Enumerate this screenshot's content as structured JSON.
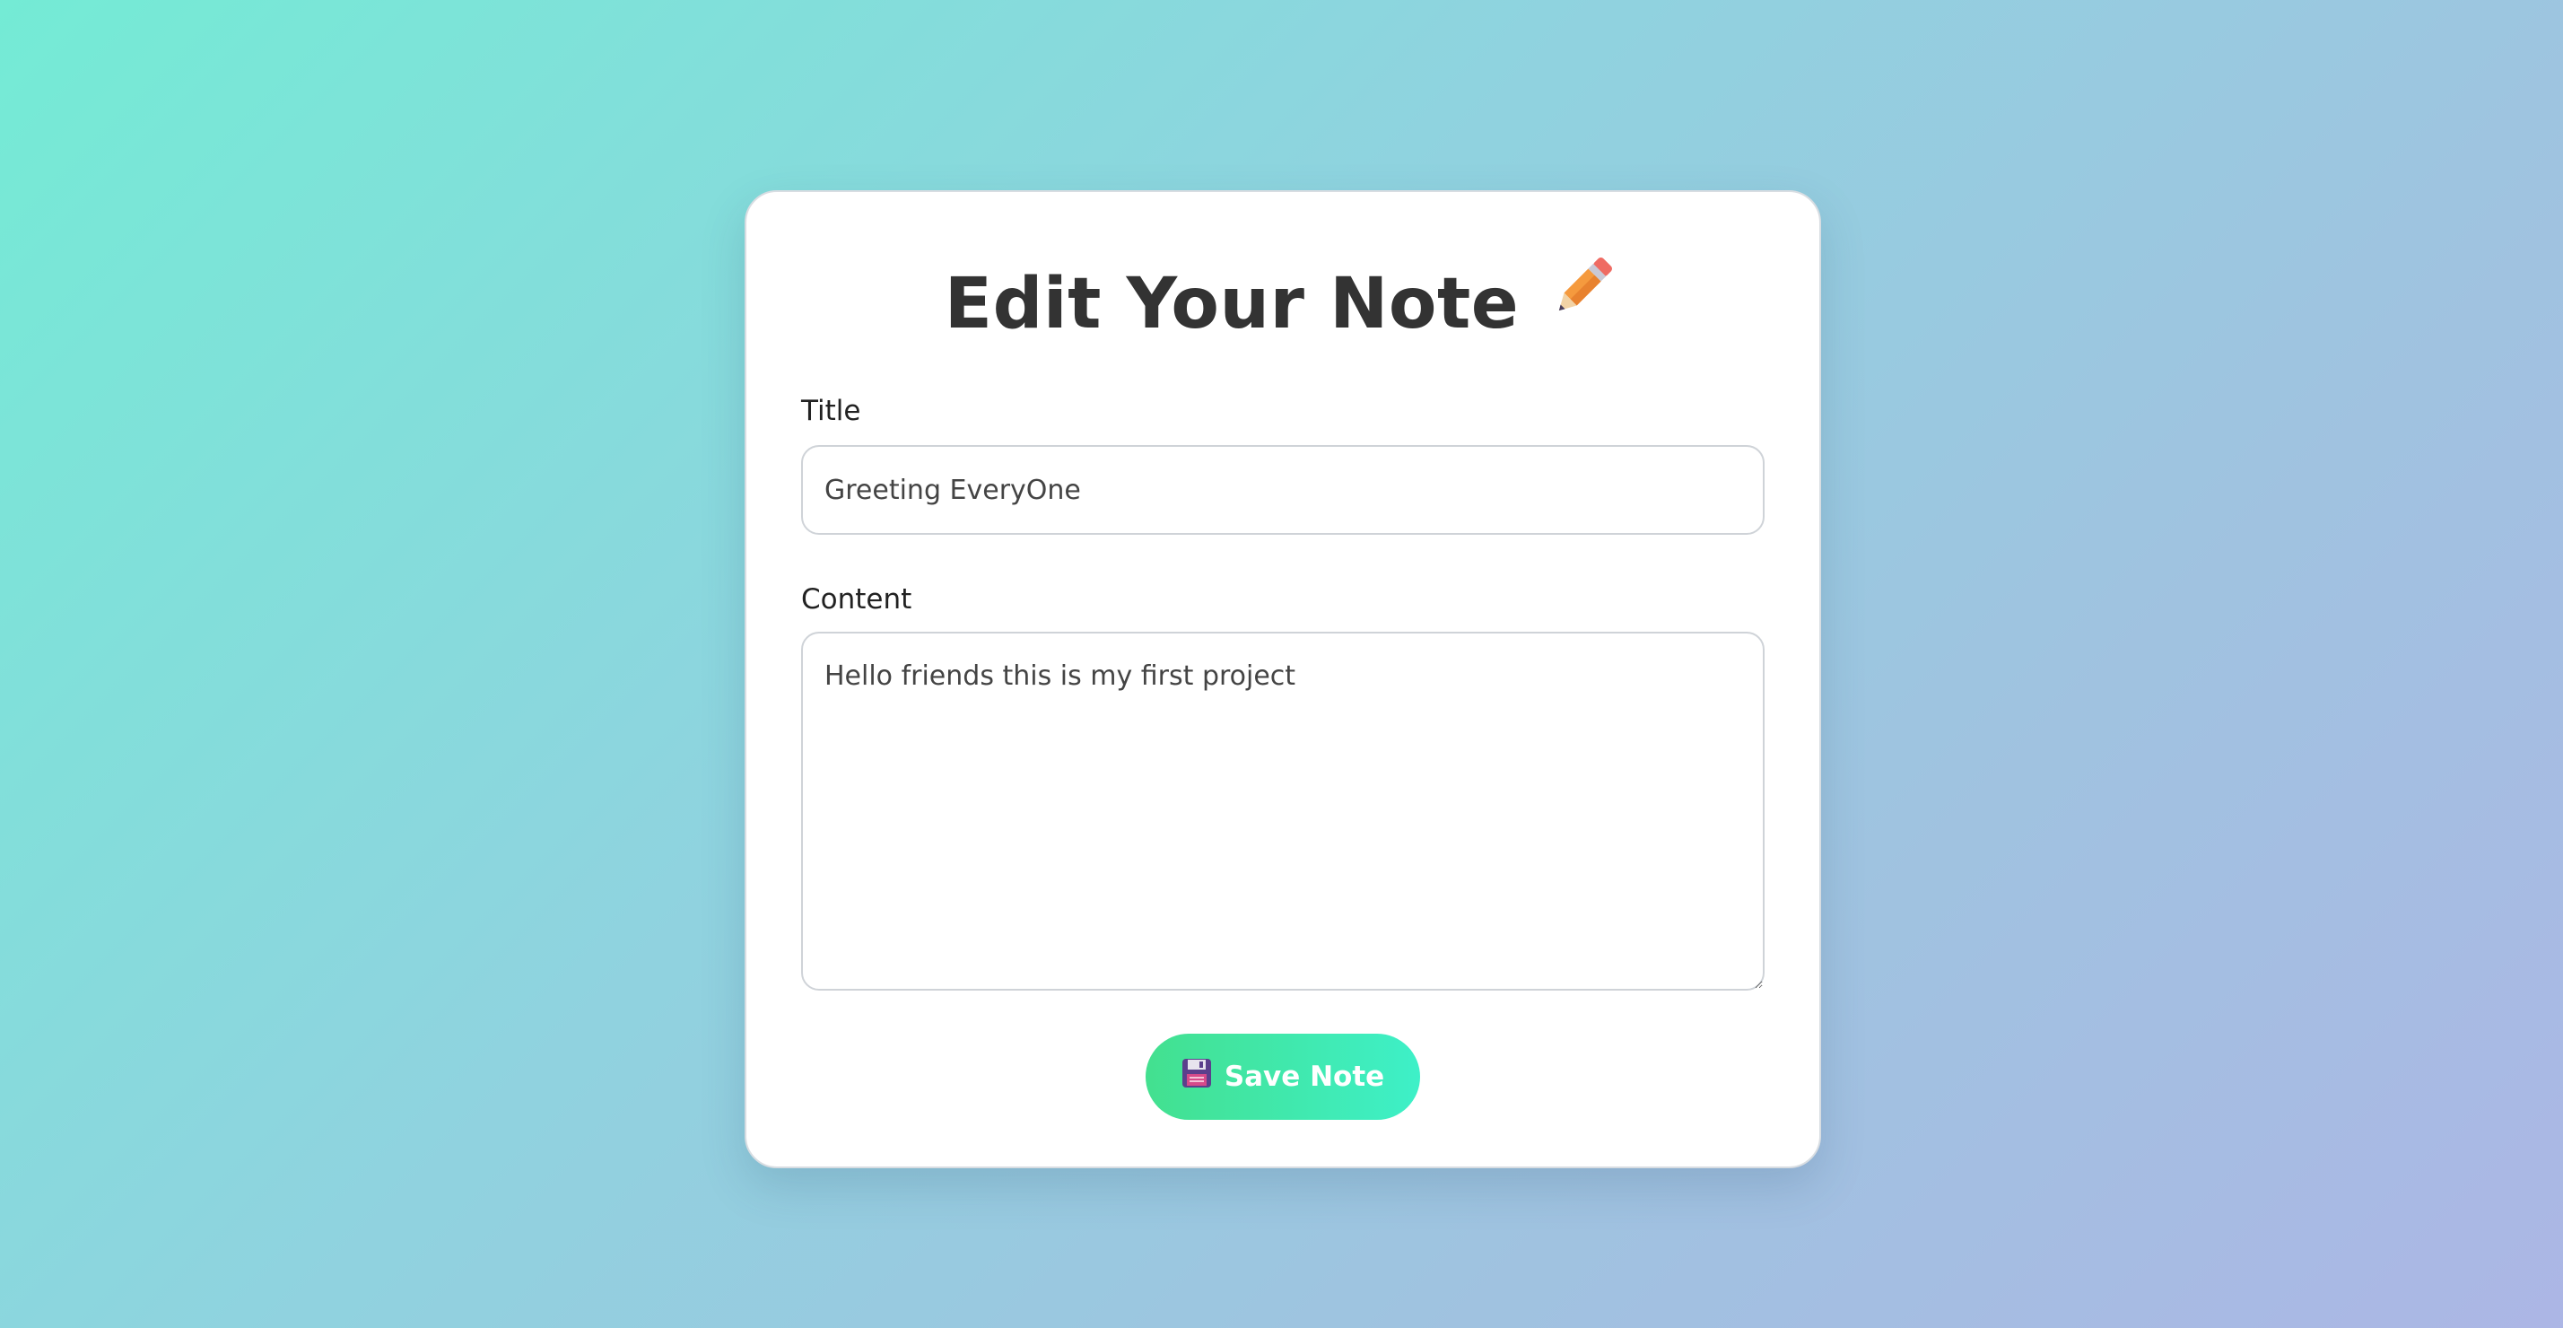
{
  "form": {
    "heading": "Edit Your Note",
    "heading_icon": "pencil-icon",
    "title_label": "Title",
    "title_value": "Greeting EveryOne",
    "content_label": "Content",
    "content_value": "Hello friends this is my first project",
    "save_label": "Save Note",
    "save_icon": "floppy-disk-icon"
  },
  "colors": {
    "background_start": "#74ebd5",
    "background_end": "#acb6e5",
    "button_start": "#43e08f",
    "button_end": "#3ef0c8",
    "heading_text": "#333333"
  }
}
